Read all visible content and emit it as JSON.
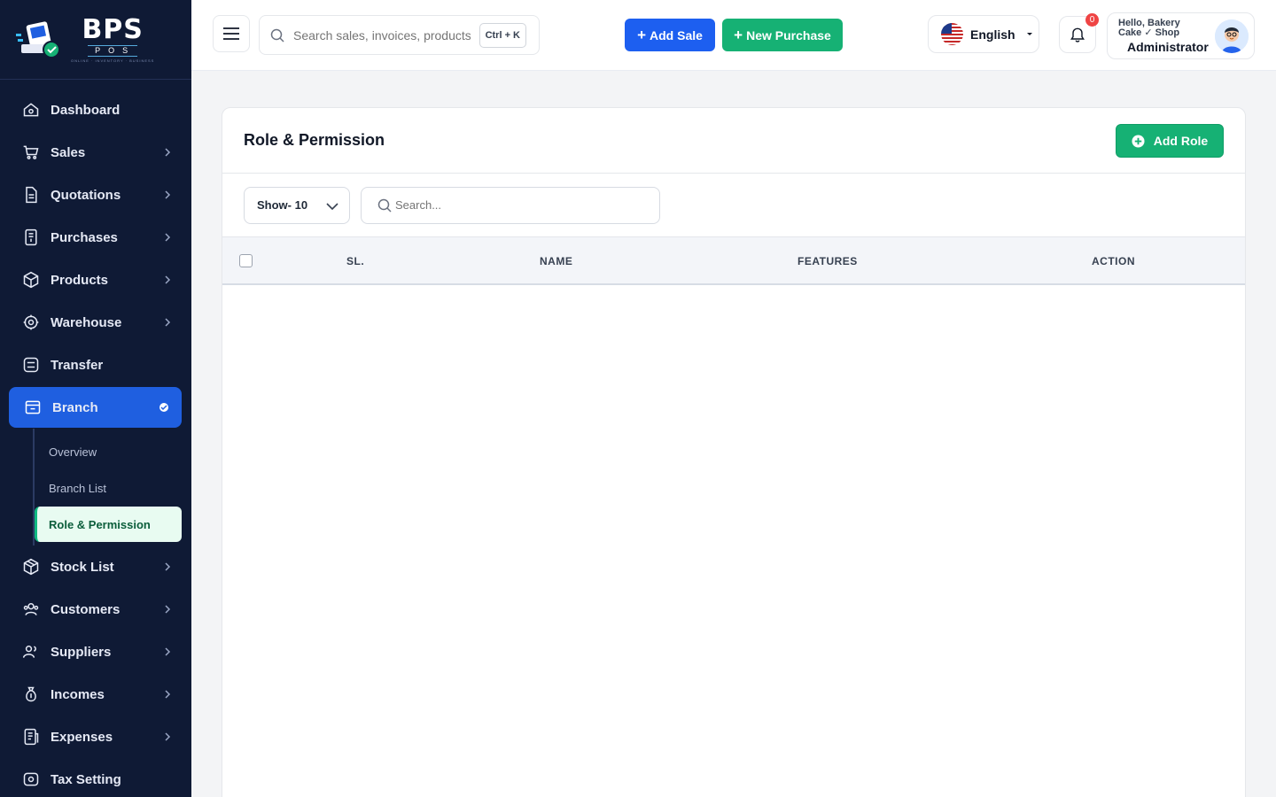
{
  "brand": {
    "name": "BPS",
    "sub": "POS",
    "tagline": "ONLINE · INVENTORY · BUSINESS"
  },
  "sidebar": {
    "items": [
      {
        "label": "Dashboard",
        "icon": "home-icon",
        "chevron": false
      },
      {
        "label": "Sales",
        "icon": "cart-icon",
        "chevron": true
      },
      {
        "label": "Quotations",
        "icon": "document-icon",
        "chevron": true
      },
      {
        "label": "Purchases",
        "icon": "receipt-icon",
        "chevron": true
      },
      {
        "label": "Products",
        "icon": "box-icon",
        "chevron": true
      },
      {
        "label": "Warehouse",
        "icon": "warehouse-icon",
        "chevron": true
      },
      {
        "label": "Transfer",
        "icon": "transfer-icon",
        "chevron": false
      },
      {
        "label": "Branch",
        "icon": "store-icon",
        "chevron": false,
        "active": true
      },
      {
        "label": "Stock List",
        "icon": "cube-icon",
        "chevron": true
      },
      {
        "label": "Customers",
        "icon": "users-icon",
        "chevron": true
      },
      {
        "label": "Suppliers",
        "icon": "supplier-icon",
        "chevron": true
      },
      {
        "label": "Incomes",
        "icon": "money-bag-icon",
        "chevron": true
      },
      {
        "label": "Expenses",
        "icon": "expense-icon",
        "chevron": true
      },
      {
        "label": "Tax Setting",
        "icon": "tax-icon",
        "chevron": false
      }
    ],
    "branch_sub": [
      {
        "label": "Overview"
      },
      {
        "label": "Branch List"
      },
      {
        "label": "Role & Permission",
        "active": true
      }
    ]
  },
  "header": {
    "search_placeholder": "Search sales, invoices, products...",
    "shortcut": "Ctrl + K",
    "add_sale": "Add Sale",
    "new_purchase": "New Purchase",
    "language": "English",
    "notification_count": "0",
    "greeting": "Hello, Bakery Cake ✓ Shop",
    "user_role": "Administrator"
  },
  "page": {
    "title": "Role & Permission",
    "add_role": "Add Role",
    "show_label": "Show- 10",
    "search_placeholder": "Search...",
    "columns": [
      "SL.",
      "NAME",
      "FEATURES",
      "ACTION"
    ]
  },
  "colors": {
    "sidebar_bg": "#0f1a35",
    "primary_blue": "#1d5ff0",
    "primary_green": "#16b174",
    "badge_red": "#ef4444"
  }
}
